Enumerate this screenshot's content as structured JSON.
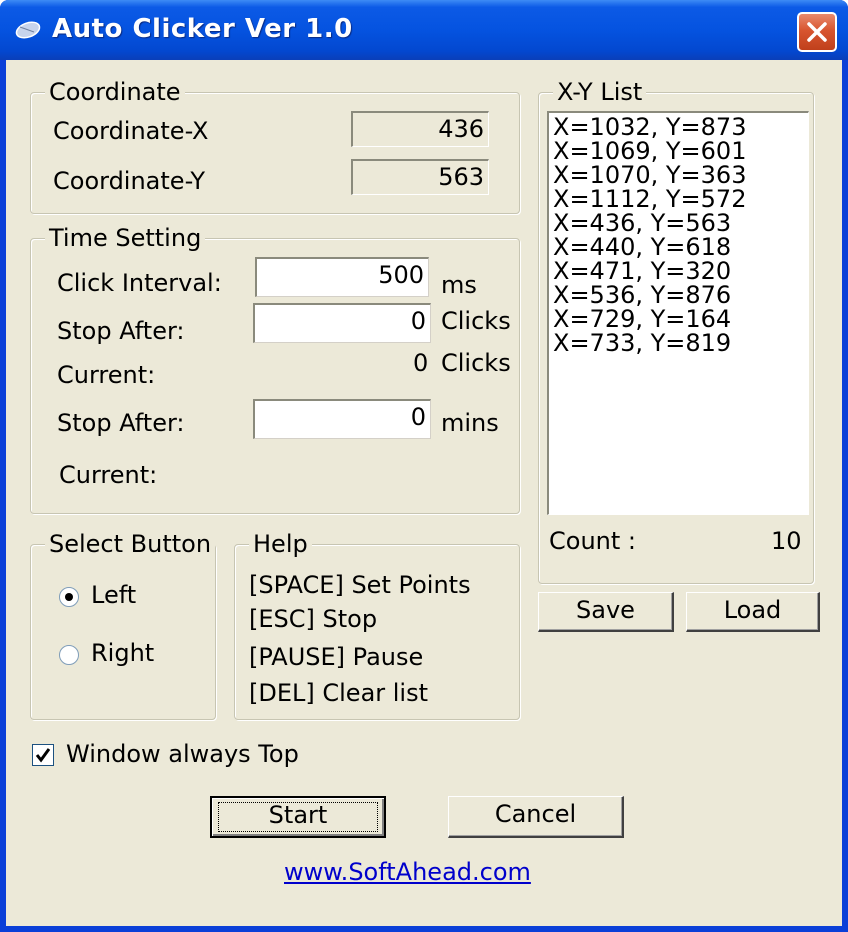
{
  "window": {
    "title": "Auto Clicker Ver 1.0"
  },
  "coordinate": {
    "legend": "Coordinate",
    "x_label": "Coordinate-X",
    "x_value": "436",
    "y_label": "Coordinate-Y",
    "y_value": "563"
  },
  "time_setting": {
    "legend": "Time Setting",
    "interval_label": "Click Interval:",
    "interval_value": "500",
    "interval_unit": "ms",
    "stop_after_clicks_label": "Stop After:",
    "stop_after_clicks_value": "0",
    "stop_after_clicks_unit": "Clicks",
    "current_clicks_label": "Current:",
    "current_clicks_value": "0",
    "current_clicks_unit": "Clicks",
    "stop_after_mins_label": "Stop After:",
    "stop_after_mins_value": "0",
    "stop_after_mins_unit": "mins",
    "current_time_label": "Current:"
  },
  "select_button": {
    "legend": "Select Button",
    "left_label": "Left",
    "right_label": "Right",
    "selected": "Left"
  },
  "help": {
    "legend": "Help",
    "lines": [
      "[SPACE] Set Points",
      "[ESC] Stop",
      "[PAUSE] Pause",
      "[DEL] Clear list"
    ]
  },
  "xy_list": {
    "legend": "X-Y List",
    "items": [
      "X=1032, Y=873",
      "X=1069, Y=601",
      "X=1070, Y=363",
      "X=1112, Y=572",
      "X=436, Y=563",
      "X=440, Y=618",
      "X=471, Y=320",
      "X=536, Y=876",
      "X=729, Y=164",
      "X=733, Y=819"
    ],
    "count_label": "Count :",
    "count_value": "10",
    "save_label": "Save",
    "load_label": "Load"
  },
  "options": {
    "always_top_label": "Window always Top",
    "always_top_checked": true
  },
  "actions": {
    "start_label": "Start",
    "cancel_label": "Cancel"
  },
  "footer": {
    "link_text": "www.SoftAhead.com"
  },
  "colors": {
    "titlebar": "#0553e0",
    "close_button": "#d8552f",
    "dialog_face": "#ece9d8",
    "link": "#0000cc"
  },
  "icons": {
    "app": "mouse-icon",
    "close": "close-icon",
    "check": "check-icon"
  }
}
